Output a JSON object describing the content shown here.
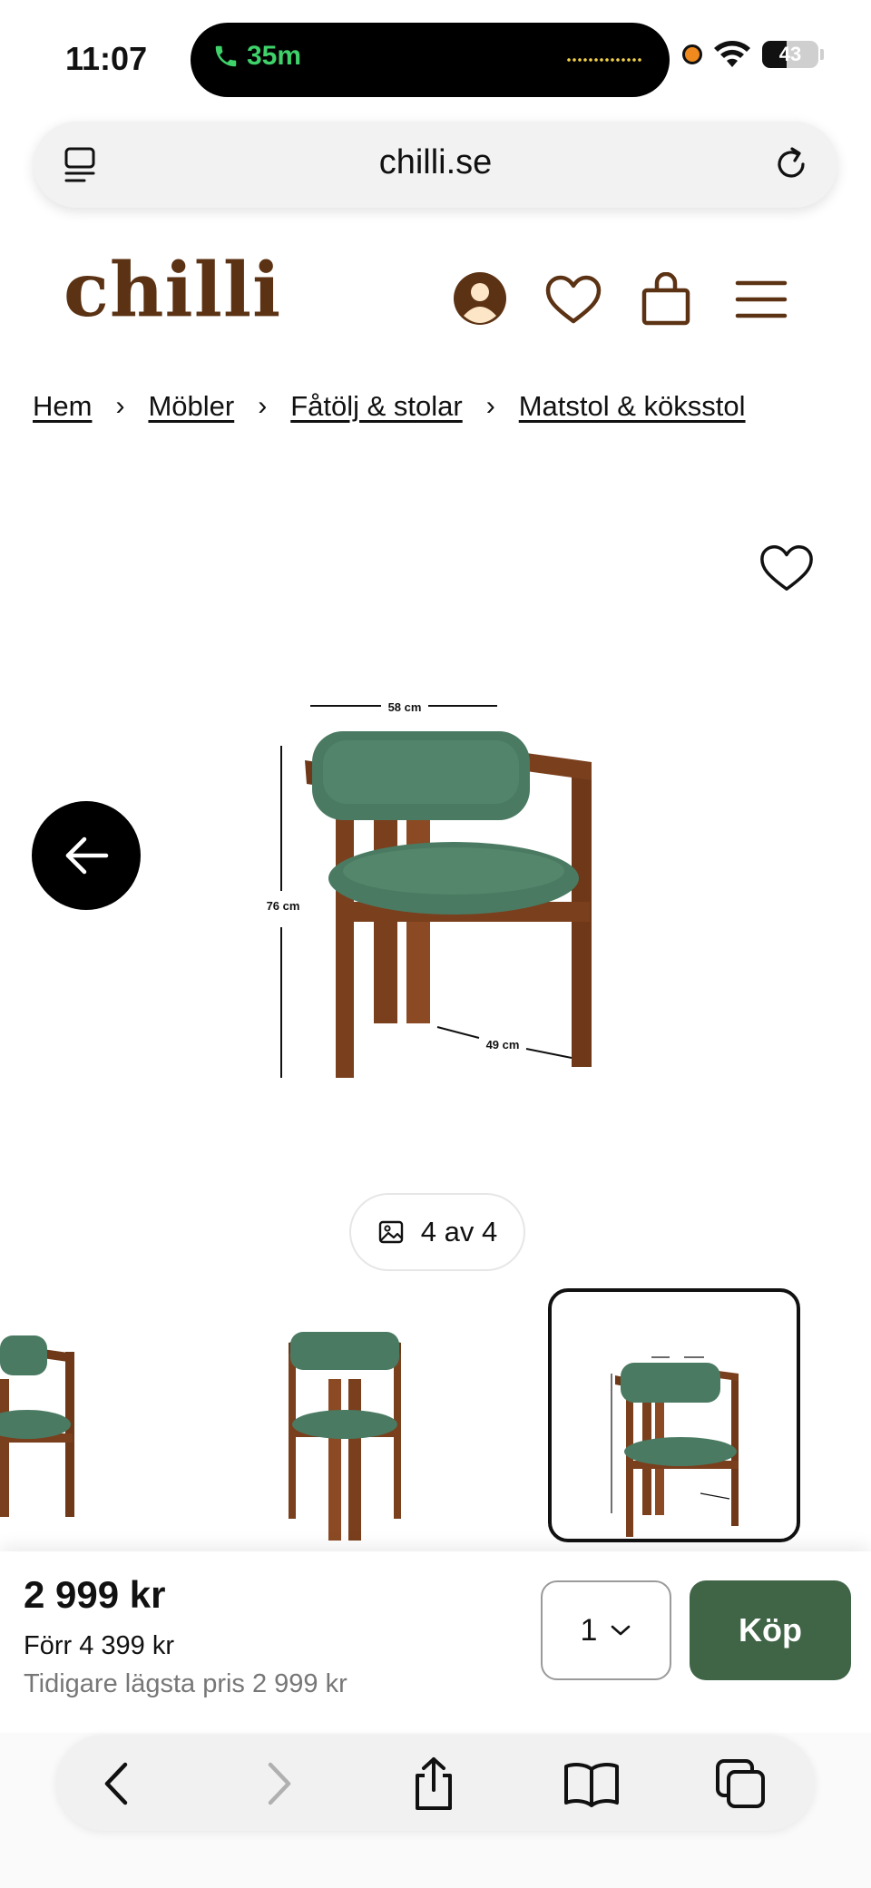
{
  "status_bar": {
    "time": "11:07",
    "call_duration": "35m",
    "battery": "43"
  },
  "browser": {
    "url": "chilli.se"
  },
  "site": {
    "logo": "chilli"
  },
  "breadcrumb": {
    "items": [
      "Hem",
      "Möbler",
      "Fåtölj & stolar",
      "Matstol & köksstol"
    ],
    "separator": "›"
  },
  "product": {
    "image_counter": "4 av 4",
    "dimensions": {
      "width": "58 cm",
      "height": "76 cm",
      "depth": "49 cm"
    },
    "price": "2 999 kr",
    "old_price": "Förr 4 399 kr",
    "lowest_price": "Tidigare lägsta pris 2 999 kr",
    "quantity": "1",
    "buy_label": "Köp"
  },
  "colors": {
    "brand_brown": "#5b3213",
    "buy_green": "#3f6446",
    "chair_green": "#4a7a62",
    "wood": "#7a3f1d"
  }
}
